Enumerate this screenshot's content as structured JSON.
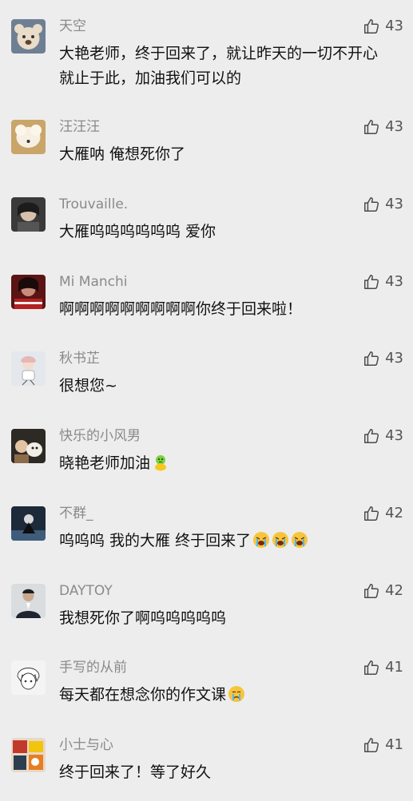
{
  "comments": [
    {
      "name": "天空",
      "text": "大艳老师，终于回来了，就让昨天的一切不开心就止于此，加油我们可以的",
      "likes": "43",
      "emoji": "",
      "avatar": "bear-avatar"
    },
    {
      "name": "汪汪汪",
      "text": "大雁呐 俺想死你了",
      "likes": "43",
      "emoji": "",
      "avatar": "dog-avatar"
    },
    {
      "name": "Trouvaille.",
      "text": "大雁呜呜呜呜呜呜 爱你",
      "likes": "43",
      "emoji": "",
      "avatar": "girl-dark-avatar"
    },
    {
      "name": "Mi Manchi",
      "text": "啊啊啊啊啊啊啊啊啊你终于回来啦！",
      "likes": "43",
      "emoji": "",
      "avatar": "red-portrait-avatar"
    },
    {
      "name": "秋书芷",
      "text": "很想您~",
      "likes": "43",
      "emoji": "",
      "avatar": "illustration-avatar"
    },
    {
      "name": "快乐的小风男",
      "text": "晓艳老师加油",
      "likes": "43",
      "emoji": "cheer-emoji",
      "avatar": "child-dog-avatar"
    },
    {
      "name": "不群_",
      "text": "呜呜呜 我的大雁 终于回来了",
      "likes": "42",
      "emoji": "crying-emoji-x3",
      "avatar": "dark-figure-avatar"
    },
    {
      "name": "DAYTOY",
      "text": "我想死你了啊呜呜呜呜呜",
      "likes": "42",
      "emoji": "",
      "avatar": "man-suit-avatar"
    },
    {
      "name": "手写的从前",
      "text": "每天都在想念你的作文课",
      "likes": "41",
      "emoji": "crying-emoji",
      "avatar": "anime-boy-avatar"
    },
    {
      "name": "小士与心",
      "text": "终于回来了！等了好久",
      "likes": "41",
      "emoji": "",
      "avatar": "collage-avatar"
    }
  ],
  "icons": {
    "like": "thumbs-up-outline-icon"
  },
  "colors": {
    "background": "#ededed",
    "name": "#8a8a8a",
    "text": "#111111",
    "like": "#555555"
  }
}
